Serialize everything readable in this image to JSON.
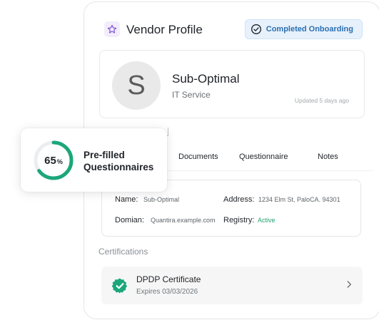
{
  "header": {
    "title": "Vendor Profile",
    "badge_label": "Completed Onboarding",
    "star_icon": "star-icon",
    "badge_icon": "check-circle-icon",
    "accent_color": "#7b4fd6",
    "badge_color": "#2b6fb1"
  },
  "profile": {
    "avatar_initial": "S",
    "name": "Sub-Optimal",
    "type": "IT Service",
    "updated": "Updated 5 days ago"
  },
  "overlay": {
    "percent": "65",
    "percent_sign": "%",
    "progress_fraction": 0.65,
    "label_line1": "Pre-filled",
    "label_line2": "Questionnaires",
    "ring_color": "#1ba77a"
  },
  "tabs": [
    {
      "label": "Documents"
    },
    {
      "label": "Questionnaire"
    },
    {
      "label": "Notes"
    }
  ],
  "details": {
    "name_label": "Name:",
    "name_value": "Sub-Optimal",
    "domain_label": "Domian:",
    "domain_value": "Quantira.example.com",
    "address_label": "Address:",
    "address_value": "1234 Elm St, PaloCA.  94301",
    "registry_label": "Registry:",
    "registry_value": "Active",
    "active_color": "#23a26d"
  },
  "certifications": {
    "heading": "Certifications",
    "items": [
      {
        "title": "DPDP Certificate",
        "subtitle": "Expires 03/03/2026",
        "icon": "verified-badge-icon",
        "chevron_icon": "chevron-right-icon"
      }
    ]
  }
}
